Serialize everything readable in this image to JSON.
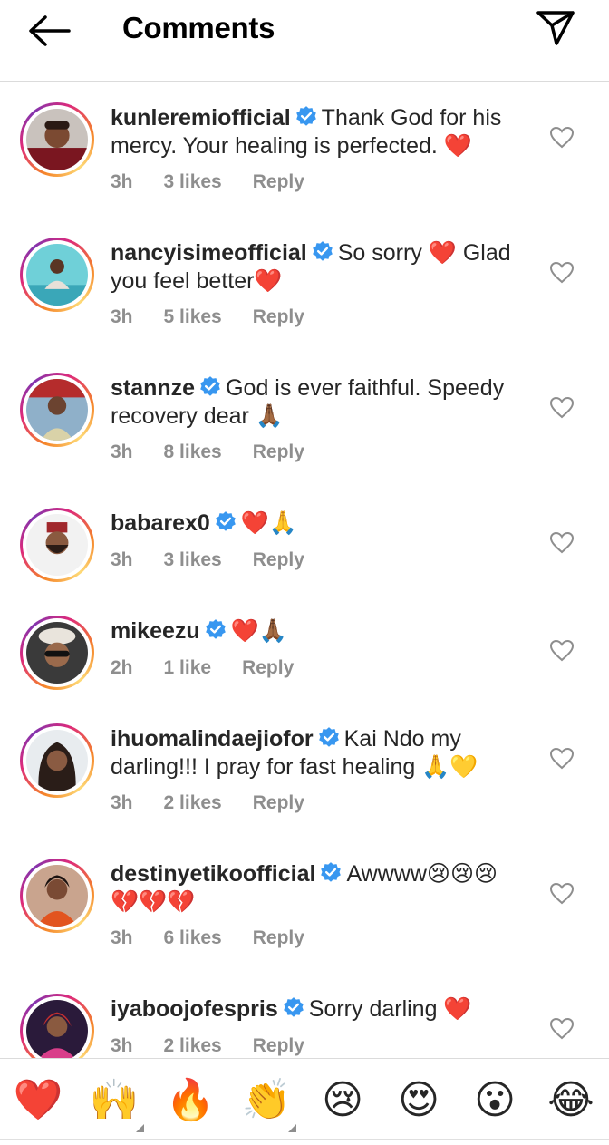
{
  "header": {
    "title": "Comments",
    "back_icon": "arrow-left-icon",
    "share_icon": "paper-plane-icon"
  },
  "colors": {
    "verified": "#3897f0",
    "meta": "#8e8e8e",
    "text": "#262626",
    "divider": "#dbdbdb"
  },
  "comments": [
    {
      "username": "kunleremiofficial",
      "text": "Thank God for his mercy. Your healing is perfected. ❤️",
      "time": "3h",
      "likes": "3 likes",
      "reply": "Reply"
    },
    {
      "username": "nancyisimeofficial",
      "text": "So sorry ❤️ Glad you feel better❤️",
      "time": "3h",
      "likes": "5 likes",
      "reply": "Reply"
    },
    {
      "username": "stannze",
      "text": "God is ever faithful. Speedy recovery dear 🙏🏾",
      "time": "3h",
      "likes": "8 likes",
      "reply": "Reply"
    },
    {
      "username": "babarex0",
      "text": "❤️🙏",
      "time": "3h",
      "likes": "3 likes",
      "reply": "Reply"
    },
    {
      "username": "mikeezu",
      "text": "❤️🙏🏾",
      "time": "2h",
      "likes": "1 like",
      "reply": "Reply"
    },
    {
      "username": "ihuomalindaejiofor",
      "text": "Kai Ndo my darling!!! I pray for fast healing 🙏💛",
      "time": "3h",
      "likes": "2 likes",
      "reply": "Reply"
    },
    {
      "username": "destinyetikoofficial",
      "text": "Awwww😢😢😢 💔💔💔",
      "time": "3h",
      "likes": "6 likes",
      "reply": "Reply"
    },
    {
      "username": "iyaboojofespris",
      "text": "Sorry darling ❤️",
      "time": "3h",
      "likes": "2 likes",
      "reply": "Reply"
    }
  ],
  "emoji_bar": [
    "❤️",
    "🙌",
    "🔥",
    "👏",
    "😢",
    "😍",
    "😮",
    "😂"
  ]
}
